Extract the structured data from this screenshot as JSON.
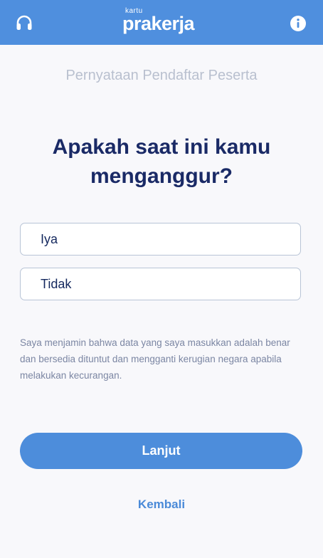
{
  "header": {
    "logo_small": "kartu",
    "logo_main": "prakerja",
    "left_icon": "headset-icon",
    "right_icon": "info-icon",
    "background_color": "#4f8fde"
  },
  "page": {
    "subtitle": "Pernyataan Pendaftar Peserta",
    "question_line1": "Apakah saat ini kamu",
    "question_line2": "menganggur?"
  },
  "options": [
    {
      "label": "Iya"
    },
    {
      "label": "Tidak"
    }
  ],
  "disclaimer": "Saya menjamin bahwa data yang saya masukkan adalah benar dan bersedia dituntut dan mengganti kerugian negara apabila melakukan kecurangan.",
  "actions": {
    "next_label": "Lanjut",
    "back_label": "Kembali"
  },
  "colors": {
    "primary": "#4d8ddb",
    "heading": "#1a2a66",
    "muted": "#b9c0cf"
  }
}
